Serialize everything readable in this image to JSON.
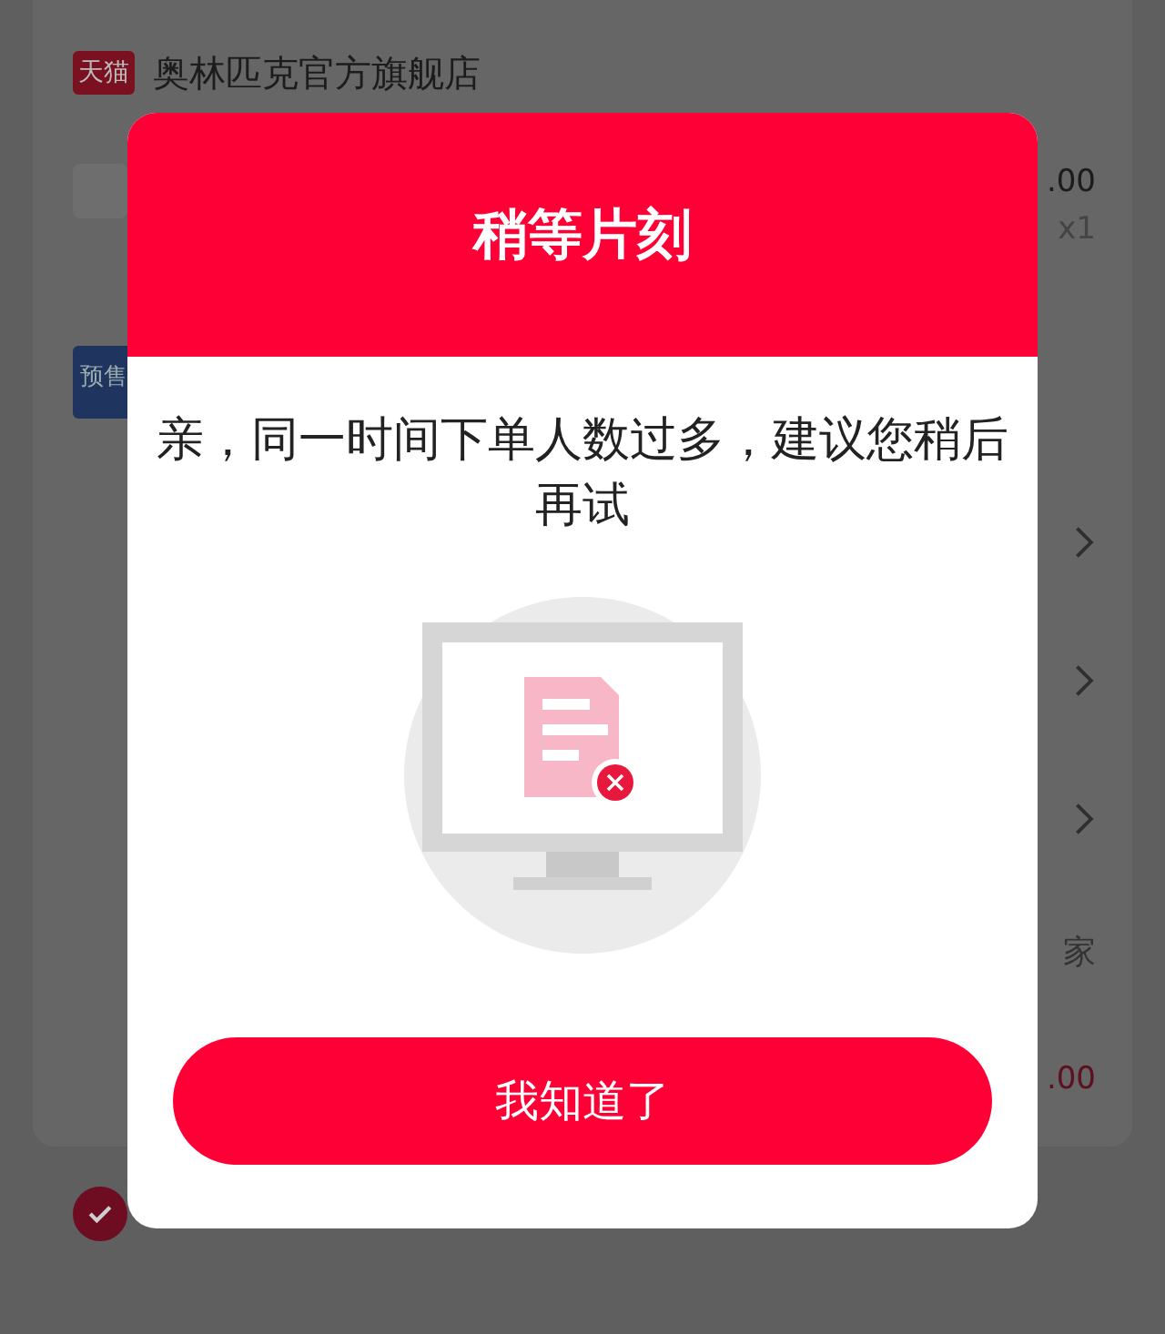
{
  "store": {
    "badge": "天猫",
    "name": "奥林匹克官方旗舰店"
  },
  "item": {
    "price": ".00",
    "quantity": "x1",
    "tag": "预售"
  },
  "seller_label": "家",
  "total": ".00",
  "agree": {
    "checked": true
  },
  "dialog": {
    "title": "稍等片刻",
    "message": "亲，同一时间下单人数过多，建议您稍后再试",
    "button": "我知道了"
  }
}
